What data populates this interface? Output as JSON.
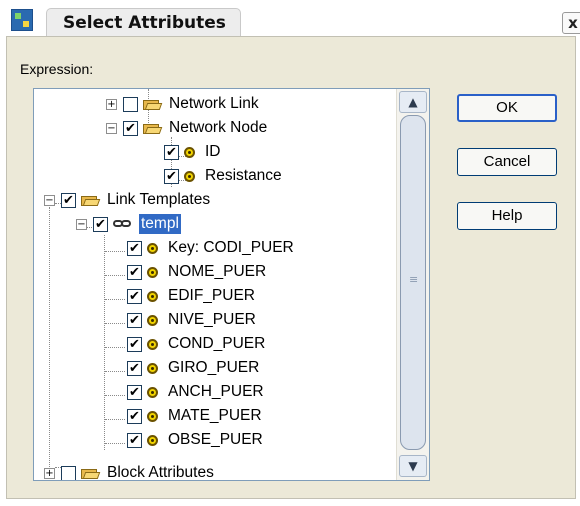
{
  "window": {
    "title": "Select Attributes",
    "close_label": "x",
    "app_icon": "app-icon"
  },
  "expression_label": "Expression:",
  "tree": {
    "nodes": [
      {
        "label": "Network Link",
        "expander": "+",
        "checked": false,
        "icon": "folder-icon"
      },
      {
        "label": "Network Node",
        "expander": "−",
        "checked": true,
        "icon": "folder-icon"
      },
      {
        "label": "ID",
        "checked": true,
        "icon": "attribute-icon"
      },
      {
        "label": "Resistance",
        "checked": true,
        "icon": "attribute-icon"
      },
      {
        "label": "Link Templates",
        "expander": "−",
        "checked": true,
        "icon": "folder-icon"
      },
      {
        "label": "templ",
        "expander": "−",
        "checked": true,
        "icon": "link-icon",
        "selected": true
      },
      {
        "label": "Key: CODI_PUER",
        "checked": true,
        "icon": "attribute-icon"
      },
      {
        "label": "NOME_PUER",
        "checked": true,
        "icon": "attribute-icon"
      },
      {
        "label": "EDIF_PUER",
        "checked": true,
        "icon": "attribute-icon"
      },
      {
        "label": "NIVE_PUER",
        "checked": true,
        "icon": "attribute-icon"
      },
      {
        "label": "COND_PUER",
        "checked": true,
        "icon": "attribute-icon"
      },
      {
        "label": "GIRO_PUER",
        "checked": true,
        "icon": "attribute-icon"
      },
      {
        "label": "ANCH_PUER",
        "checked": true,
        "icon": "attribute-icon"
      },
      {
        "label": "MATE_PUER",
        "checked": true,
        "icon": "attribute-icon"
      },
      {
        "label": "OBSE_PUER",
        "checked": true,
        "icon": "attribute-icon"
      },
      {
        "label": "Block Attributes",
        "expander": "+",
        "checked": false,
        "icon": "folder-icon"
      }
    ],
    "check_glyph": "✔"
  },
  "scrollbar": {
    "up_glyph": "▲",
    "down_glyph": "▼",
    "grip_glyph": "≡"
  },
  "buttons": {
    "ok": "OK",
    "cancel": "Cancel",
    "help": "Help"
  },
  "colors": {
    "selection": "#316ac5",
    "dialog_bg": "#ece9d8",
    "button_border": "#003c74"
  }
}
